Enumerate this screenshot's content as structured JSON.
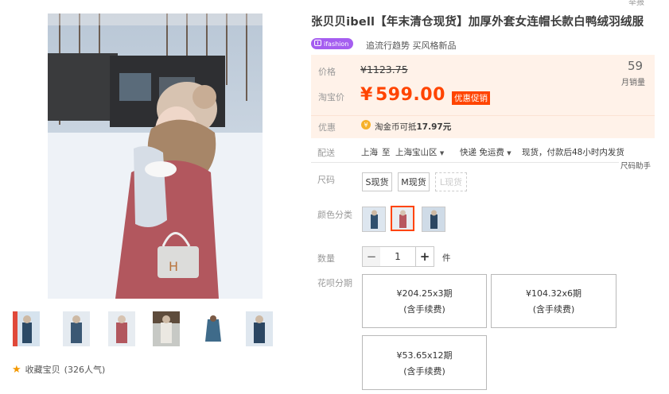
{
  "header": {
    "report_label": "举报"
  },
  "product": {
    "title": "张贝贝ibell【年末清仓现货】加厚外套女连帽长款白鸭绒羽绒服",
    "badge_text": "ifashion",
    "subtitle": "追流行趋势 买风格新品"
  },
  "price": {
    "original_label": "价格",
    "original_value": "¥1123.75",
    "current_label": "淘宝价",
    "currency": "¥",
    "current_value": "599.00",
    "promo_label": "优惠促销",
    "sales_count": "59",
    "sales_label": "月销量",
    "discount_label": "优惠",
    "coin_icon_text": "¥",
    "coin_text": "淘金币可抵",
    "coin_amount": "17.97元"
  },
  "delivery": {
    "label": "配送",
    "from": "上海",
    "to_word": "至",
    "to": "上海宝山区",
    "express": "快递 免运费",
    "note": "现货，付款后48小时内发货",
    "size_helper": "尺码助手"
  },
  "size": {
    "label": "尺码",
    "options": [
      {
        "label": "S现货",
        "available": true
      },
      {
        "label": "M现货",
        "available": true
      },
      {
        "label": "L现货",
        "available": false
      }
    ]
  },
  "color": {
    "label": "颜色分类",
    "selected_index": 1,
    "options": [
      {
        "swatch": "#7f8ea3",
        "coat": "#30506e"
      },
      {
        "swatch": "#c9c1c0",
        "coat": "#b8575e"
      },
      {
        "swatch": "#a5b3c7",
        "coat": "#2b4662"
      }
    ]
  },
  "quantity": {
    "label": "数量",
    "minus": "−",
    "value": "1",
    "plus": "+",
    "unit": "件"
  },
  "installment": {
    "label": "花呗分期",
    "options": [
      {
        "amount": "¥204.25x3期",
        "fee": "(含手续费)"
      },
      {
        "amount": "¥104.32x6期",
        "fee": "(含手续费)"
      },
      {
        "amount": "¥53.65x12期",
        "fee": "(含手续费)"
      }
    ]
  },
  "favorite": {
    "label": "收藏宝贝",
    "popularity": "(326人气)"
  },
  "colors": {
    "accent": "#ff4400",
    "price_bg": "#fff2e9",
    "badge": "#a55ef0",
    "coin": "#f6b12a"
  }
}
